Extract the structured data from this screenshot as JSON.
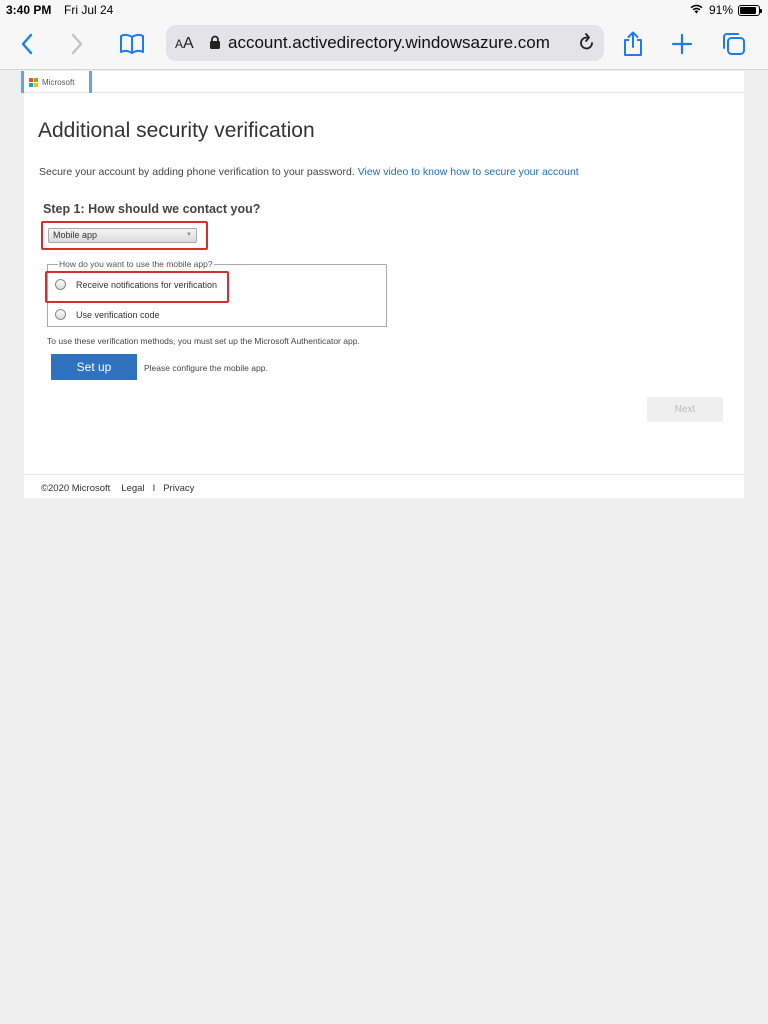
{
  "status_bar": {
    "time": "3:40 PM",
    "date": "Fri Jul 24",
    "battery_text": "91%",
    "battery_level": 0.91
  },
  "browser": {
    "text_size_label": "AA",
    "url": "account.activedirectory.windowsazure.com",
    "icons": [
      "back-icon",
      "forward-icon",
      "bookmarks-icon",
      "lock-icon",
      "reload-icon",
      "share-icon",
      "new-tab-icon",
      "tabs-icon"
    ]
  },
  "page": {
    "brand": "Microsoft",
    "title": "Additional security verification",
    "intro_text": "Secure your account by adding phone verification to your password.",
    "intro_link": "View video to know how to secure your account",
    "step_label": "Step 1: How should we contact you?",
    "contact_method": "Mobile app",
    "fieldset_legend": "How do you want to use the mobile app?",
    "radio_options": [
      {
        "label": "Receive notifications for verification"
      },
      {
        "label": "Use verification code"
      }
    ],
    "note": "To use these verification methods, you must set up the Microsoft Authenticator app.",
    "setup_button": "Set up",
    "setup_message": "Please configure the mobile app.",
    "next_button": "Next"
  },
  "footer": {
    "copyright": "©2020 Microsoft",
    "legal": "Legal",
    "separator": "I",
    "privacy": "Privacy"
  },
  "colors": {
    "accent_link": "#1a6fb8",
    "button_primary": "#2f72bf",
    "highlight_box": "#d32f2f",
    "safari_blue": "#1a7cf4"
  }
}
